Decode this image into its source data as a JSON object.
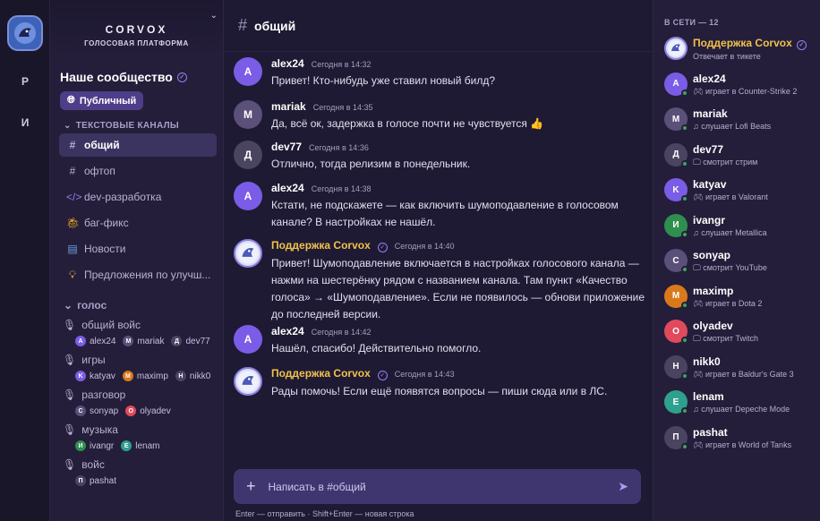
{
  "rail": {
    "items": [
      "Р",
      "И"
    ]
  },
  "brand": {
    "name": "CORVOX",
    "subtitle": "ГОЛОСОВАЯ ПЛАТФОРМА"
  },
  "server": {
    "name": "Наше сообщество",
    "public_label": "Публичный"
  },
  "text_section": "ТЕКСТОВЫЕ КАНАЛЫ",
  "text_channels": [
    {
      "icon": "#",
      "name": "общий",
      "active": true
    },
    {
      "icon": "#",
      "name": "офтоп"
    },
    {
      "icon": "</>",
      "name": "dev-разработка"
    },
    {
      "icon": "bug",
      "name": "баг-фикс"
    },
    {
      "icon": "news",
      "name": "Новости"
    },
    {
      "icon": "bulb",
      "name": "Предложения по улучш..."
    }
  ],
  "voice_section": "голос",
  "voice_channels": [
    {
      "name": "общий войс",
      "users": [
        {
          "n": "alex24",
          "i": "A",
          "c": "#7b5ce6"
        },
        {
          "n": "mariak",
          "i": "M",
          "c": "#5a5078"
        },
        {
          "n": "dev77",
          "i": "Д",
          "c": "#4a4460"
        }
      ]
    },
    {
      "name": "игры",
      "users": [
        {
          "n": "katyav",
          "i": "K",
          "c": "#7b5ce6"
        },
        {
          "n": "maximp",
          "i": "M",
          "c": "#d97a1a"
        },
        {
          "n": "nikk0",
          "i": "H",
          "c": "#4a4460"
        }
      ]
    },
    {
      "name": "разговор",
      "users": [
        {
          "n": "sonyap",
          "i": "C",
          "c": "#5a5078"
        },
        {
          "n": "olyadev",
          "i": "O",
          "c": "#e04a5c"
        }
      ]
    },
    {
      "name": "музыка",
      "users": [
        {
          "n": "ivangr",
          "i": "И",
          "c": "#2f8f4e"
        },
        {
          "n": "lenam",
          "i": "E",
          "c": "#2ea08e"
        }
      ]
    },
    {
      "name": "войс",
      "users": [
        {
          "n": "pashat",
          "i": "П",
          "c": "#4a4460"
        }
      ]
    }
  ],
  "channel": {
    "hash": "#",
    "name": "общий"
  },
  "messages": [
    {
      "author": "alex24",
      "initial": "A",
      "color": "#7b5ce6",
      "time": "Сегодня в 14:32",
      "text": "Привет! Кто-нибудь уже ставил новый билд?"
    },
    {
      "author": "mariak",
      "initial": "M",
      "color": "#5a5078",
      "time": "Сегодня в 14:35",
      "text": "Да, всё ок, задержка в голосе почти не чувствуется 👍"
    },
    {
      "author": "dev77",
      "initial": "Д",
      "color": "#4a4460",
      "time": "Сегодня в 14:36",
      "text": "Отлично, тогда релизим в понедельник."
    },
    {
      "author": "alex24",
      "initial": "A",
      "color": "#7b5ce6",
      "time": "Сегодня в 14:38",
      "text": "Кстати, не подскажете — как включить шумоподавление в голосовом канале? В настройках не нашёл."
    },
    {
      "author": "Поддержка Corvox",
      "support": true,
      "time": "Сегодня в 14:40",
      "text": "Привет! Шумоподавление включается в настройках голосового канала — нажми на шестерёнку рядом с названием канала. Там пункт «Качество голоса» → «Шумоподавление». Если не появилось — обнови приложение до последней версии."
    },
    {
      "author": "alex24",
      "initial": "A",
      "color": "#7b5ce6",
      "time": "Сегодня в 14:42",
      "text": "Нашёл, спасибо! Действительно помогло."
    },
    {
      "author": "Поддержка Corvox",
      "support": true,
      "time": "Сегодня в 14:43",
      "text": "Рады помочь! Если ещё появятся вопросы — пиши сюда или в ЛС."
    }
  ],
  "composer": {
    "placeholder": "Написать в #общий",
    "hint": "Enter — отправить · Shift+Enter — новая строка"
  },
  "members": {
    "header": "В СЕТИ — 12",
    "list": [
      {
        "name": "Поддержка Corvox",
        "support": true,
        "activity": "Отвечает в тикете"
      },
      {
        "name": "alex24",
        "initial": "A",
        "color": "#7b5ce6",
        "icon": "game",
        "activity": "играет в Counter-Strike 2"
      },
      {
        "name": "mariak",
        "initial": "M",
        "color": "#5a5078",
        "icon": "music",
        "activity": "слушает Lofi Beats"
      },
      {
        "name": "dev77",
        "initial": "Д",
        "color": "#4a4460",
        "icon": "stream",
        "activity": "смотрит стрим"
      },
      {
        "name": "katyav",
        "initial": "K",
        "color": "#7b5ce6",
        "icon": "game",
        "activity": "играет в Valorant"
      },
      {
        "name": "ivangr",
        "initial": "И",
        "color": "#2f8f4e",
        "icon": "music",
        "activity": "слушает Metallica"
      },
      {
        "name": "sonyap",
        "initial": "C",
        "color": "#5a5078",
        "icon": "stream",
        "activity": "смотрит YouTube"
      },
      {
        "name": "maximp",
        "initial": "M",
        "color": "#d97a1a",
        "icon": "game",
        "activity": "играет в Dota 2"
      },
      {
        "name": "olyadev",
        "initial": "O",
        "color": "#e04a5c",
        "icon": "stream",
        "activity": "смотрит Twitch"
      },
      {
        "name": "nikk0",
        "initial": "H",
        "color": "#4a4460",
        "icon": "game",
        "activity": "играет в Baldur's Gate 3"
      },
      {
        "name": "lenam",
        "initial": "E",
        "color": "#2ea08e",
        "icon": "music",
        "activity": "слушает Depeche Mode"
      },
      {
        "name": "pashat",
        "initial": "П",
        "color": "#4a4460",
        "icon": "game",
        "activity": "играет в World of Tanks"
      }
    ]
  }
}
